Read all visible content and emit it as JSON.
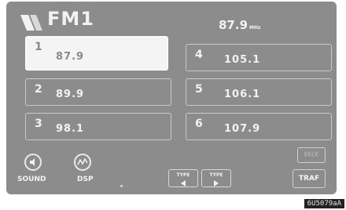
{
  "header": {
    "band_icon": "antenna-signal-icon",
    "band": "FM1",
    "frequency": "87.9",
    "unit": "MHz"
  },
  "presets": [
    {
      "number": "1",
      "frequency": "87.9",
      "selected": true
    },
    {
      "number": "2",
      "frequency": "89.9",
      "selected": false
    },
    {
      "number": "3",
      "frequency": "98.1",
      "selected": false
    },
    {
      "number": "4",
      "frequency": "105.1",
      "selected": false
    },
    {
      "number": "5",
      "frequency": "106.1",
      "selected": false
    },
    {
      "number": "6",
      "frequency": "107.9",
      "selected": false
    }
  ],
  "bottom_bar": {
    "sound_label": "SOUND",
    "sound_icon": "speaker-icon",
    "dsp_label": "DSP",
    "dsp_icon": "dsp-wave-icon",
    "type_prev": "TYPE",
    "type_next": "TYPE",
    "upper_right_button": "MIX",
    "traf_button": "TRAF"
  },
  "footer": {
    "code": "6U5079aA"
  },
  "colors": {
    "screen_background": "#8c8c8c",
    "selected_preset": "#f4f4f4",
    "text": "#f2f2f2"
  }
}
